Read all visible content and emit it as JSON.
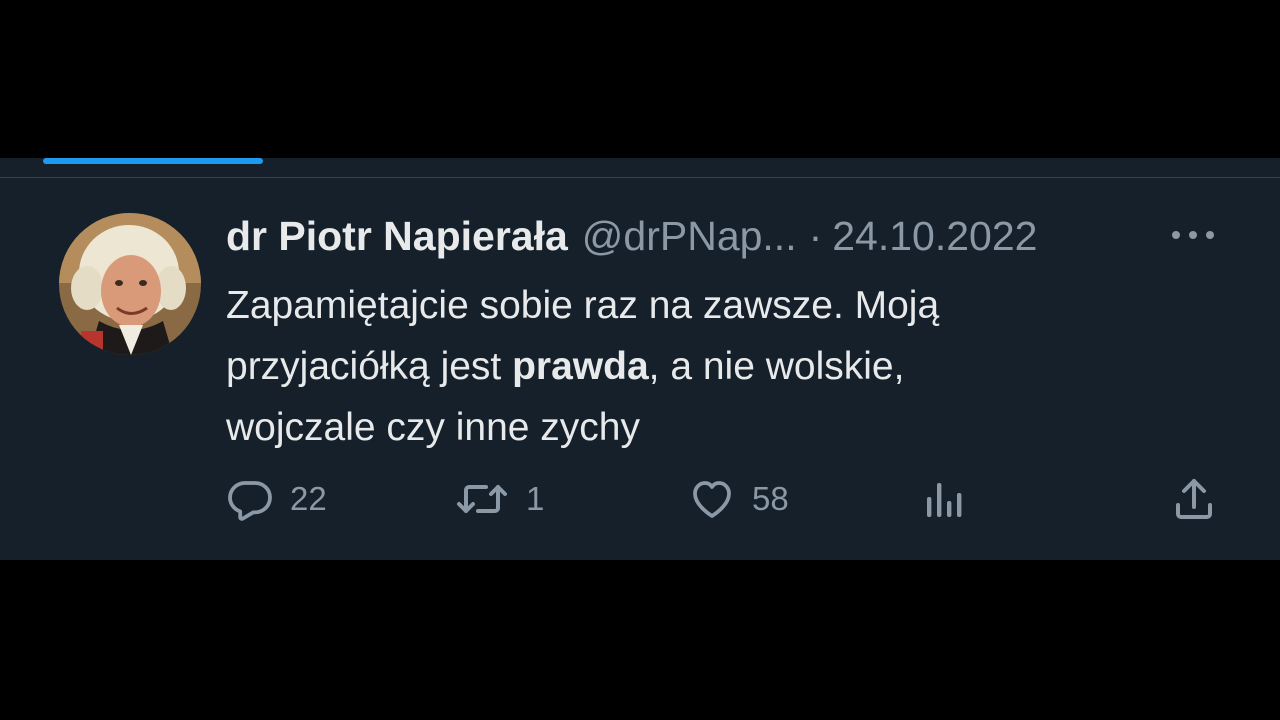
{
  "tweet": {
    "author": {
      "display_name": "dr Piotr Napierała",
      "handle": "@drPNap...",
      "avatar_icon": "avatar-portrait-icon"
    },
    "separator": "·",
    "date": "24.10.2022",
    "more_icon": "more-horizontal-icon",
    "text": {
      "line1": "Zapamiętajcie sobie raz na zawsze. Moją",
      "line2_before": "przyjaciółką jest ",
      "line2_bold": "prawda",
      "line2_after": ", a nie wolskie,",
      "line3": "wojczale czy inne zychy"
    },
    "actions": {
      "reply": {
        "icon": "reply-icon",
        "count": "22"
      },
      "retweet": {
        "icon": "retweet-icon",
        "count": "1"
      },
      "like": {
        "icon": "heart-icon",
        "count": "58"
      },
      "views": {
        "icon": "bar-chart-icon"
      },
      "share": {
        "icon": "share-icon"
      }
    }
  },
  "colors": {
    "background": "#15202b",
    "text_primary": "#e7e9ea",
    "text_secondary": "#8b98a5",
    "accent": "#1d9bf0",
    "letterbox": "#000000"
  }
}
